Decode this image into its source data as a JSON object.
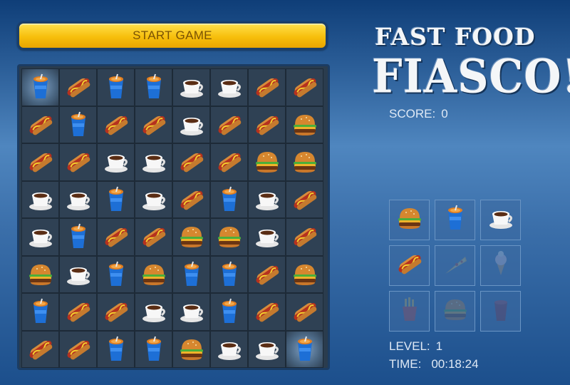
{
  "start_button": {
    "label": "START GAME"
  },
  "logo": {
    "line1": "FAST FOOD",
    "line2": "FIASCO!"
  },
  "score": {
    "label": "SCORE:",
    "value": "0"
  },
  "level": {
    "label": "LEVEL:",
    "value": "1"
  },
  "time": {
    "label": "TIME:",
    "value": "00:18:24"
  },
  "colors": {
    "button": "#f7bf0c",
    "board_bg": "#2f4154",
    "text": "#dfe9f5"
  },
  "board": {
    "highlighted": [
      [
        0,
        0
      ],
      [
        7,
        7
      ]
    ],
    "rows": [
      [
        "soda",
        "hotdog",
        "soda",
        "soda",
        "coffee",
        "coffee",
        "hotdog",
        "hotdog"
      ],
      [
        "hotdog",
        "soda",
        "hotdog",
        "hotdog",
        "coffee",
        "hotdog",
        "hotdog",
        "burger"
      ],
      [
        "hotdog",
        "hotdog",
        "coffee",
        "coffee",
        "hotdog",
        "hotdog",
        "burger",
        "burger"
      ],
      [
        "coffee",
        "coffee",
        "soda",
        "coffee",
        "hotdog",
        "soda",
        "coffee",
        "hotdog"
      ],
      [
        "coffee",
        "soda",
        "hotdog",
        "hotdog",
        "burger",
        "burger",
        "coffee",
        "hotdog"
      ],
      [
        "burger",
        "coffee",
        "soda",
        "burger",
        "soda",
        "soda",
        "hotdog",
        "burger"
      ],
      [
        "soda",
        "hotdog",
        "hotdog",
        "coffee",
        "coffee",
        "soda",
        "hotdog",
        "hotdog"
      ],
      [
        "hotdog",
        "hotdog",
        "soda",
        "soda",
        "burger",
        "coffee",
        "coffee",
        "soda"
      ]
    ]
  },
  "palette": [
    {
      "icon": "burger",
      "active": true
    },
    {
      "icon": "soda",
      "active": true
    },
    {
      "icon": "coffee",
      "active": true
    },
    {
      "icon": "hotdog",
      "active": true
    },
    {
      "icon": "pizza",
      "active": false
    },
    {
      "icon": "icecream",
      "active": false
    },
    {
      "icon": "fries",
      "active": false
    },
    {
      "icon": "burger",
      "active": false
    },
    {
      "icon": "cup",
      "active": false
    }
  ]
}
